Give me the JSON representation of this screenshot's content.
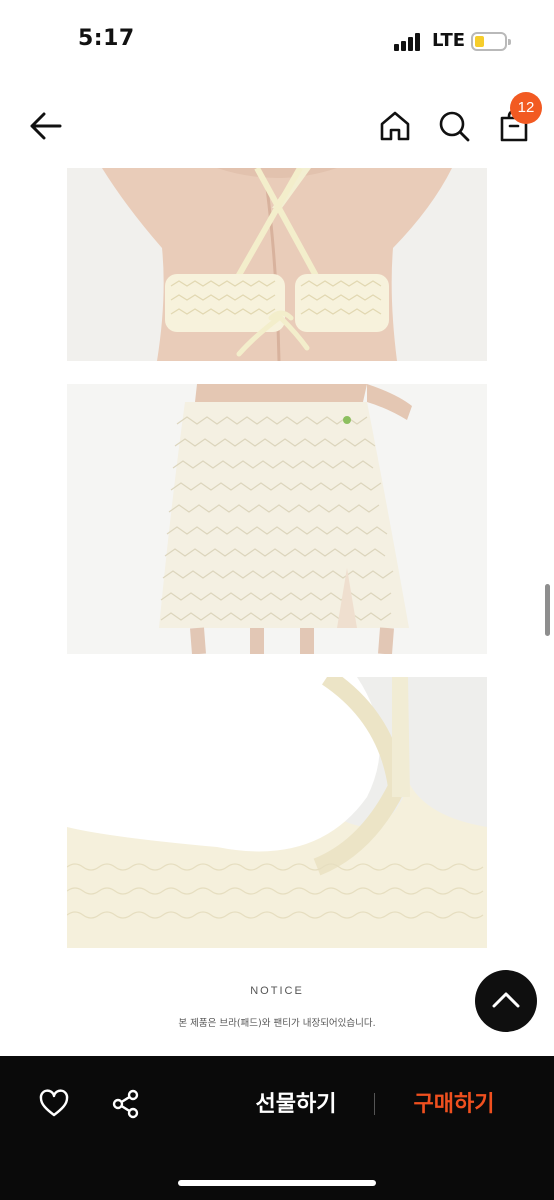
{
  "status_bar": {
    "time": "5:17",
    "network": "LTE",
    "battery_color": "#f6cd2b"
  },
  "header": {
    "back_icon": "arrow-left-icon",
    "home_icon": "home-icon",
    "search_icon": "search-icon",
    "cart_icon": "shopping-bag-icon",
    "cart_count": "12",
    "badge_color": "#f25a22"
  },
  "photos": [
    {
      "name": "bikini-top-back-view"
    },
    {
      "name": "lace-mini-skirt-front-view"
    },
    {
      "name": "bra-pad-detail"
    }
  ],
  "notice": {
    "title": "NOTICE",
    "text": "본 제품은 브라(패드)와 팬티가 내장되어있습니다."
  },
  "bottom_bar": {
    "like_icon": "heart-icon",
    "share_icon": "share-icon",
    "gift_label": "선물하기",
    "buy_label": "구매하기",
    "buy_color": "#f0501f"
  },
  "scroll_top_icon": "chevron-up-icon"
}
